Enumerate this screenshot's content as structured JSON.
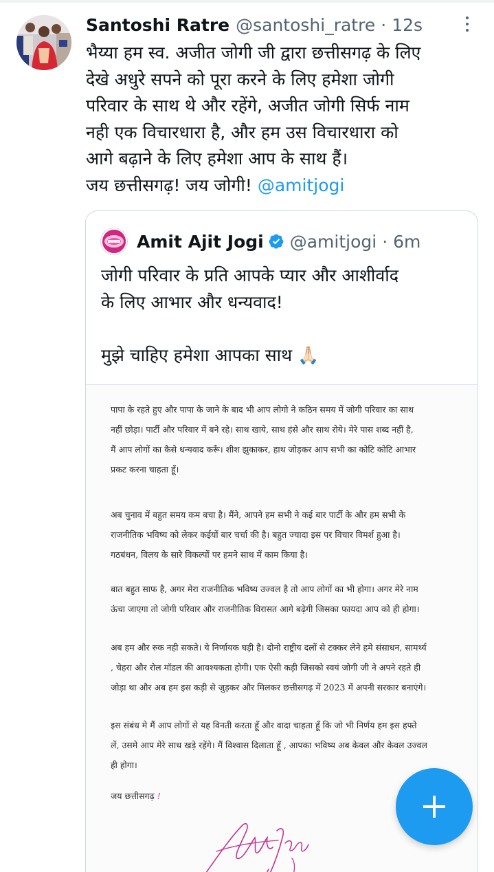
{
  "tweet": {
    "display_name": "Santoshi Ratre",
    "handle": "@santoshi_ratre",
    "separator": "·",
    "time": "12s",
    "text_lines": [
      "भैय्या हम स्व. अजीत जोगी जी द्वारा छत्तीसगढ़ के लिए",
      "देखे अधुरे सपने को पूरा करने के लिए हमेशा जोगी",
      "परिवार के साथ थे और रहेंगे, अजीत जोगी सिर्फ नाम",
      "नही एक विचारधारा है, और हम उस विचारधारा को",
      "आगे बढ़ाने के लिए हमेशा आप के साथ हैं।"
    ],
    "last_line_text": "जय छत्तीसगढ़! जय जोगी! ",
    "mention": "@amitjogi",
    "more_icon": "more-vertical-icon"
  },
  "quote": {
    "display_name": "Amit Ajit Jogi",
    "verified_icon": "verified-badge-icon",
    "handle": "@amitjogi",
    "separator": "·",
    "time": "6m",
    "text_lines": [
      "जोगी परिवार के प्रति आपके प्यार और आशीर्वाद",
      "के लिए आभार और धन्यवाद!"
    ],
    "text_line_2": "मुझे चाहिए हमेशा आपका साथ 🙏🏻",
    "letter": {
      "paragraphs": [
        [
          "पापा के रहते हुए और पापा के जाने के बाद भी आप लोगो ने कठिन समय में जोगी परिवार का साथ",
          "नहीं छोड़ा। पार्टी और परिवार में बने रहे। साथ खाये, साथ हंसे और साथ रोये। मेरे पास शब्द नहीं है,",
          "मैं आप लोगों का कैसे धन्यवाद करूँ। शीश झुकाकर, हाथ जोड़कर आप सभी का कोटि कोटि आभार",
          "प्रकट करना चाहता हूँ।"
        ],
        [
          "अब चुनाव में बहुत समय कम बचा है। मैंने, आपने हम सभी ने कई बार पार्टी के और हम सभी के",
          "राजनीतिक भविष्य को लेकर कईयों बार चर्चा की है। बहुत ज्यादा इस पर विचार विमर्श हुआ है।",
          "गठबंधन, विलय के सारे विकल्पों पर हमने साथ में काम किया है।"
        ],
        [
          "बात बहुत साफ है, अगर मेरा राजनीतिक भविष्य उज्वल है तो आप लोगों का भी होगा। अगर मेरे नाम",
          "ऊंचा जाएगा तो जोगी परिवार और राजनीतिक विरासत आगे बढ़ेगी जिसका फायदा आप को ही होगा।"
        ],
        [
          "अब हम और रुक नही सकते। ये निर्णायक घड़ी है। दोनो राष्ट्रीय दलों से टक्कर लेने हमे संसाधन, सामर्थ्य",
          ", चेहरा और रोल मॉडल की आवश्यकता होगी। एक ऐसी कड़ी जिसको स्वयं जोगी जी ने अपने रहते ही",
          "जोड़ा था और अब हम इस कड़ी से जुड़कर और मिलकर छत्तीसगढ़ में 2023 में अपनी सरकार बनाएंगे।"
        ],
        [
          "इस संबंध मे मैं आप लोगों से यह विनती करता हूँ और वादा चाहता हूँ कि जो भी निर्णय हम इस हफ्ते",
          "लें, उसमे आप मेरे साथ खड़े रहेंगे। मैं विश्वास दिलाता हूँ , आपका भविष्य अब केवल और केवल उज्वल",
          "ही होगा।"
        ]
      ],
      "closing": "जय छत्तीसगढ़",
      "closing_mark": "!"
    }
  },
  "fab": {
    "icon": "plus-icon",
    "color": "#1d9bf0"
  },
  "colors": {
    "accent": "#1d9bf0",
    "text": "#0f1419",
    "secondary": "#536471",
    "border": "#cfd9de",
    "brand_pink": "#d02680"
  }
}
